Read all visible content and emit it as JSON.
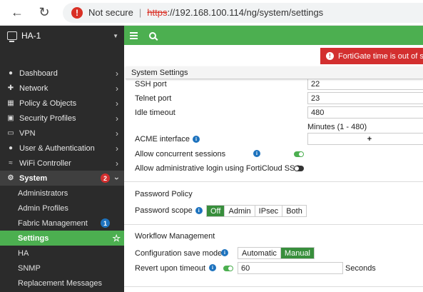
{
  "browser": {
    "not_secure": "Not secure",
    "url_scheme": "https",
    "url_rest": "://192.168.100.114/ng/system/settings"
  },
  "sidebar": {
    "device": "HA-1",
    "items": [
      {
        "label": "Dashboard",
        "icon": "dashboard-icon"
      },
      {
        "label": "Network",
        "icon": "network-icon"
      },
      {
        "label": "Policy & Objects",
        "icon": "policy-icon"
      },
      {
        "label": "Security Profiles",
        "icon": "lock-icon"
      },
      {
        "label": "VPN",
        "icon": "monitor-icon"
      },
      {
        "label": "User & Authentication",
        "icon": "user-icon"
      },
      {
        "label": "WiFi Controller",
        "icon": "wifi-icon"
      }
    ],
    "system": {
      "label": "System",
      "badge": "2"
    },
    "sub_items": [
      {
        "label": "Administrators"
      },
      {
        "label": "Admin Profiles"
      },
      {
        "label": "Fabric Management",
        "badge": "1"
      },
      {
        "label": "Settings"
      },
      {
        "label": "HA"
      },
      {
        "label": "SNMP"
      },
      {
        "label": "Replacement Messages"
      }
    ]
  },
  "alert": {
    "text": "FortiGate time is out of sync"
  },
  "page": {
    "title": "System Settings"
  },
  "settings": {
    "ssh_port": {
      "label": "SSH port",
      "value": "22"
    },
    "telnet_port": {
      "label": "Telnet port",
      "value": "23"
    },
    "idle_timeout": {
      "label": "Idle timeout",
      "value": "480",
      "hint": "Minutes (1 - 480)"
    },
    "acme": {
      "label": "ACME interface",
      "button": "+"
    },
    "concurrent": {
      "label": "Allow concurrent sessions",
      "enabled": true
    },
    "forticloud": {
      "label": "Allow administrative login using FortiCloud SSO",
      "enabled": false
    },
    "password_policy": {
      "title": "Password Policy",
      "scope_label": "Password scope",
      "options": [
        "Off",
        "Admin",
        "IPsec",
        "Both"
      ],
      "selected": "Off"
    },
    "workflow": {
      "title": "Workflow Management",
      "save_mode_label": "Configuration save mode",
      "save_mode_options": [
        "Automatic",
        "Manual"
      ],
      "save_mode_selected": "Manual",
      "revert_label": "Revert upon timeout",
      "revert_enabled": true,
      "revert_value": "60",
      "revert_unit": "Seconds"
    }
  },
  "colors": {
    "accent_green": "#4caf50",
    "sidebar_bg": "#2b2b2b",
    "alert_red": "#d32f2f",
    "info_blue": "#1e73be"
  }
}
